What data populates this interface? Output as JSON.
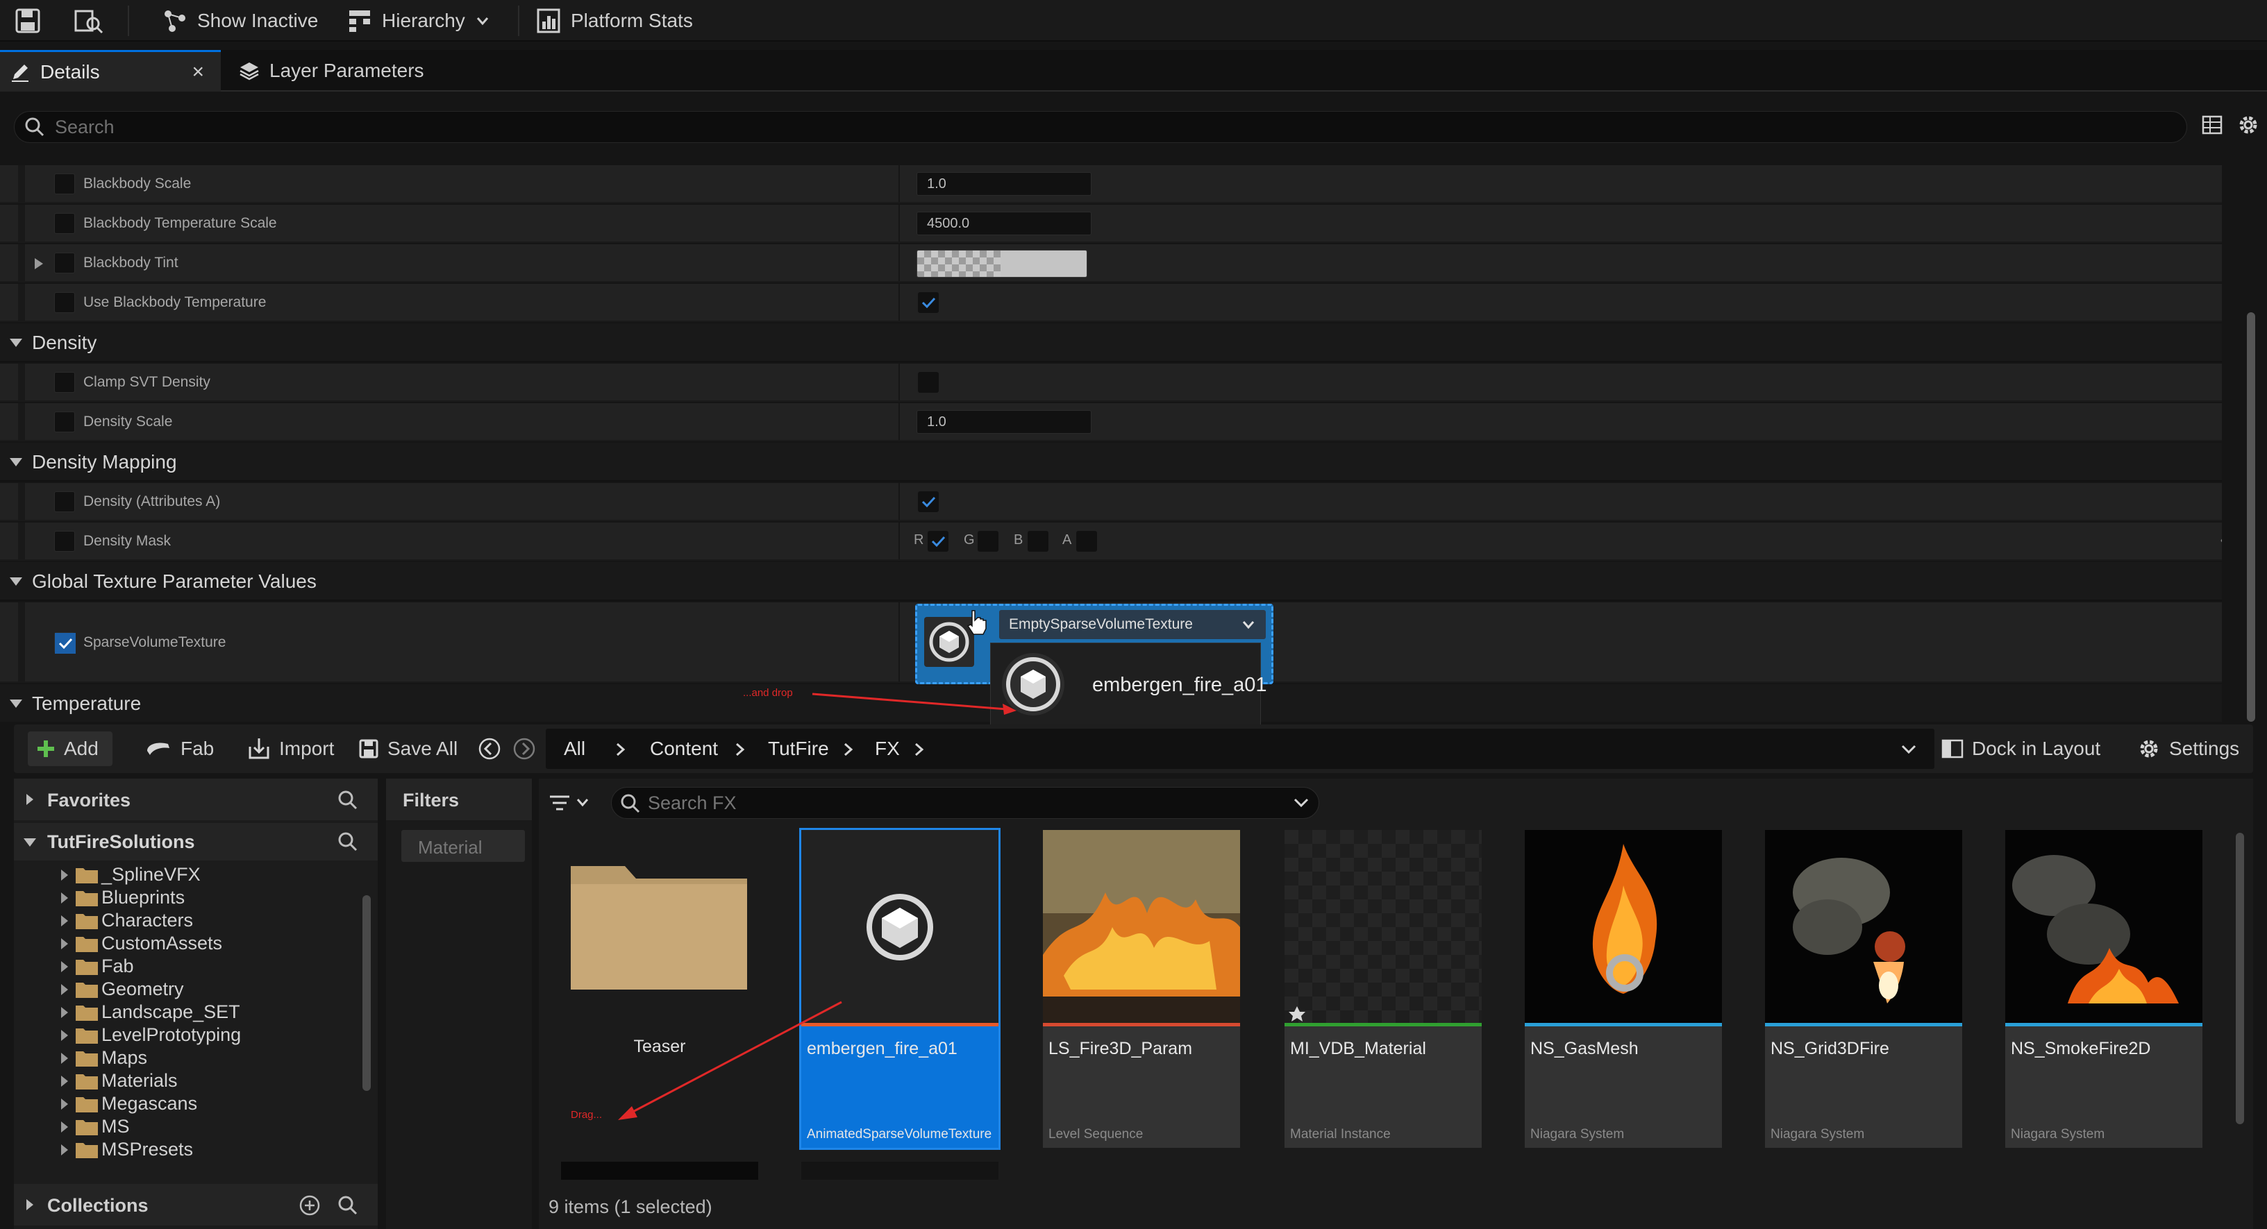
{
  "toolbar": {
    "show_inactive": "Show Inactive",
    "hierarchy": "Hierarchy",
    "platform_stats": "Platform Stats"
  },
  "tabs": {
    "details": "Details",
    "close": "×",
    "layer_parameters": "Layer Parameters"
  },
  "search": {
    "placeholder": "Search"
  },
  "details": {
    "blackbody_scale": {
      "label": "Blackbody Scale",
      "value": "1.0"
    },
    "blackbody_temperature_scale": {
      "label": "Blackbody Temperature Scale",
      "value": "4500.0"
    },
    "blackbody_tint": {
      "label": "Blackbody Tint"
    },
    "use_blackbody_temperature": {
      "label": "Use Blackbody Temperature",
      "checked": true
    },
    "cat_density": "Density",
    "clamp_svt_density": {
      "label": "Clamp SVT Density",
      "checked": false
    },
    "density_scale": {
      "label": "Density Scale",
      "value": "1.0"
    },
    "cat_density_mapping": "Density Mapping",
    "density_attributes_a": {
      "label": "Density (Attributes A)",
      "checked": true
    },
    "density_mask": {
      "label": "Density Mask",
      "channels": [
        "R",
        "G",
        "B",
        "A"
      ],
      "checked": [
        true,
        false,
        false,
        false
      ]
    },
    "cat_global_texture": "Global Texture Parameter Values",
    "sparse_volume_texture": {
      "label": "SparseVolumeTexture",
      "checked": true,
      "asset": "EmptySparseVolumeTexture"
    },
    "cat_temperature": "Temperature"
  },
  "drag": {
    "tooltip_name": "embergen_fire_a01",
    "annotation_drop": "...and drop",
    "annotation_drag": "Drag..."
  },
  "content_browser": {
    "add": "Add",
    "fab": "Fab",
    "import": "Import",
    "save_all": "Save All",
    "breadcrumb": [
      "All",
      "Content",
      "TutFire",
      "FX"
    ],
    "dock_in_layout": "Dock in Layout",
    "settings": "Settings",
    "favorites": "Favorites",
    "root": "TutFireSolutions",
    "folders": [
      "_SplineVFX",
      "Blueprints",
      "Characters",
      "CustomAssets",
      "Fab",
      "Geometry",
      "Landscape_SET",
      "LevelPrototyping",
      "Maps",
      "Materials",
      "Megascans",
      "MS",
      "MSPresets"
    ],
    "collections": "Collections",
    "filters": "Filters",
    "filter_chip": "Material",
    "search_placeholder": "Search FX",
    "status": "9 items (1 selected)",
    "assets": [
      {
        "name": "Teaser",
        "type": "",
        "kind": "folder"
      },
      {
        "name": "embergen_fire_a01",
        "type": "AnimatedSparseVolumeTexture",
        "kind": "svt",
        "selected": true
      },
      {
        "name": "LS_Fire3D_Param",
        "type": "Level Sequence",
        "kind": "sequence"
      },
      {
        "name": "MI_VDB_Material",
        "type": "Material Instance",
        "kind": "material"
      },
      {
        "name": "NS_GasMesh",
        "type": "Niagara System",
        "kind": "niagara"
      },
      {
        "name": "NS_Grid3DFire",
        "type": "Niagara System",
        "kind": "niagara"
      },
      {
        "name": "NS_SmokeFire2D",
        "type": "Niagara System",
        "kind": "niagara"
      }
    ]
  },
  "colors": {
    "accent": "#0070e0",
    "selection": "#0a74da",
    "level_sequence_bar": "#d84a30",
    "material_bar": "#30a030",
    "niagara_bar": "#2aa0d8",
    "annotation": "#e02828"
  }
}
